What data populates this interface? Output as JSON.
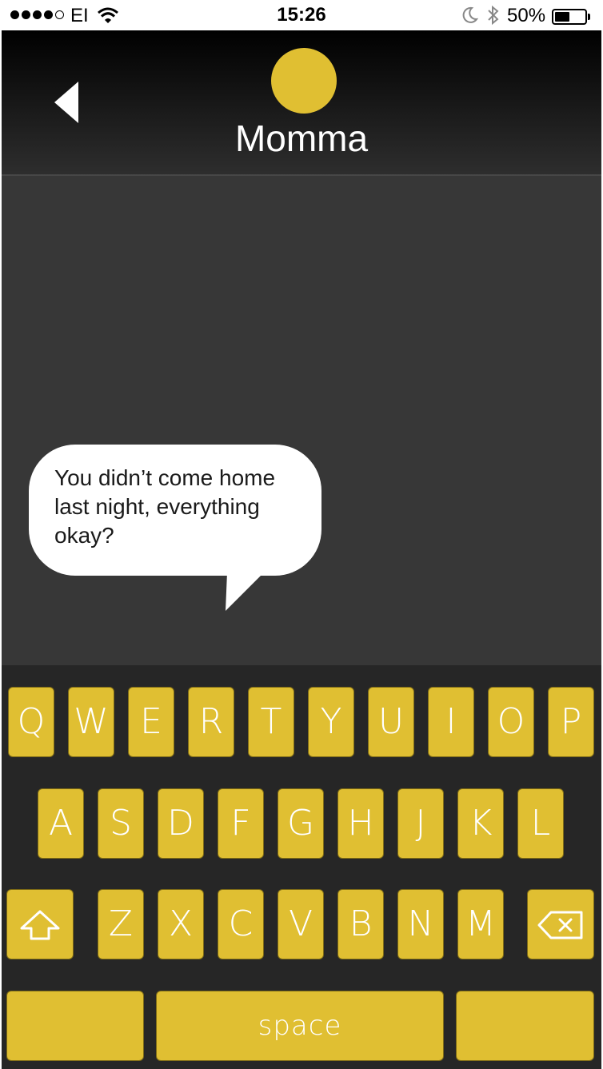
{
  "status_bar": {
    "carrier": "EI",
    "time": "15:26",
    "battery_percent": "50%",
    "battery_level": 0.5,
    "signal_bars": 4,
    "signal_max": 5
  },
  "header": {
    "contact_name": "Momma",
    "avatar_color": "#e0bf32"
  },
  "messages": [
    {
      "sender": "Momma",
      "text": "You didn’t come home last night, everything okay?"
    }
  ],
  "keyboard": {
    "row1": [
      "Q",
      "W",
      "E",
      "R",
      "T",
      "Y",
      "U",
      "I",
      "O",
      "P"
    ],
    "row2": [
      "A",
      "S",
      "D",
      "F",
      "G",
      "H",
      "J",
      "K",
      "L"
    ],
    "row3": [
      "Z",
      "X",
      "C",
      "V",
      "B",
      "N",
      "M"
    ],
    "shift_icon": "shift-arrow-icon",
    "backspace_icon": "backspace-icon",
    "space_label": "space",
    "key_color": "#e0bf32",
    "background_color": "#262626"
  }
}
